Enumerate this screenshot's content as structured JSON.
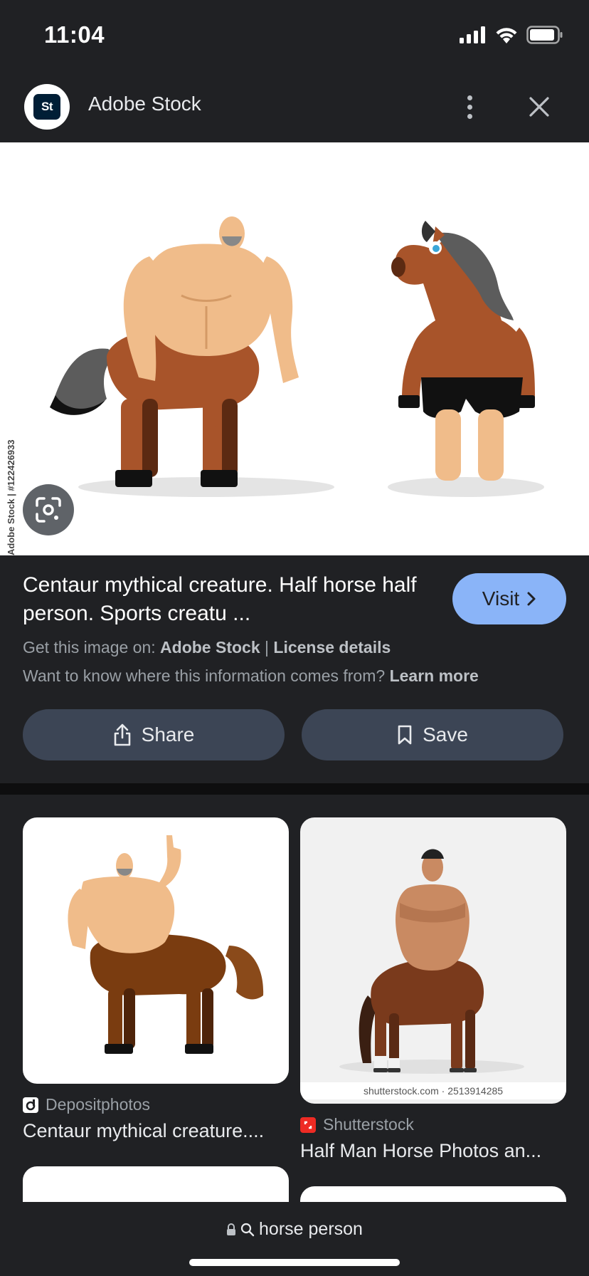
{
  "status_bar": {
    "time": "11:04"
  },
  "header": {
    "site_name": "Adobe Stock",
    "logo_text": "St"
  },
  "hero": {
    "credit": "Adobe Stock | #122426933"
  },
  "info": {
    "title": "Centaur mythical creature. Half horse half person. Sports creatu ...",
    "visit_label": "Visit",
    "get_image_prefix": "Get this image on:",
    "get_image_source": "Adobe Stock",
    "separator": "|",
    "license_label": "License details",
    "info_question": "Want to know where this information comes from?",
    "learn_more": "Learn more",
    "share_label": "Share",
    "save_label": "Save"
  },
  "results": [
    {
      "source": "Depositphotos",
      "title": "Centaur mythical creature....",
      "favicon_color": "#ffffff"
    },
    {
      "source": "Shutterstock",
      "title": "Half Man Horse Photos an...",
      "favicon_color": "#ee2b24",
      "watermark": "shutterstock.com · 2513914285"
    }
  ],
  "bottom_bar": {
    "url": "horse person"
  }
}
